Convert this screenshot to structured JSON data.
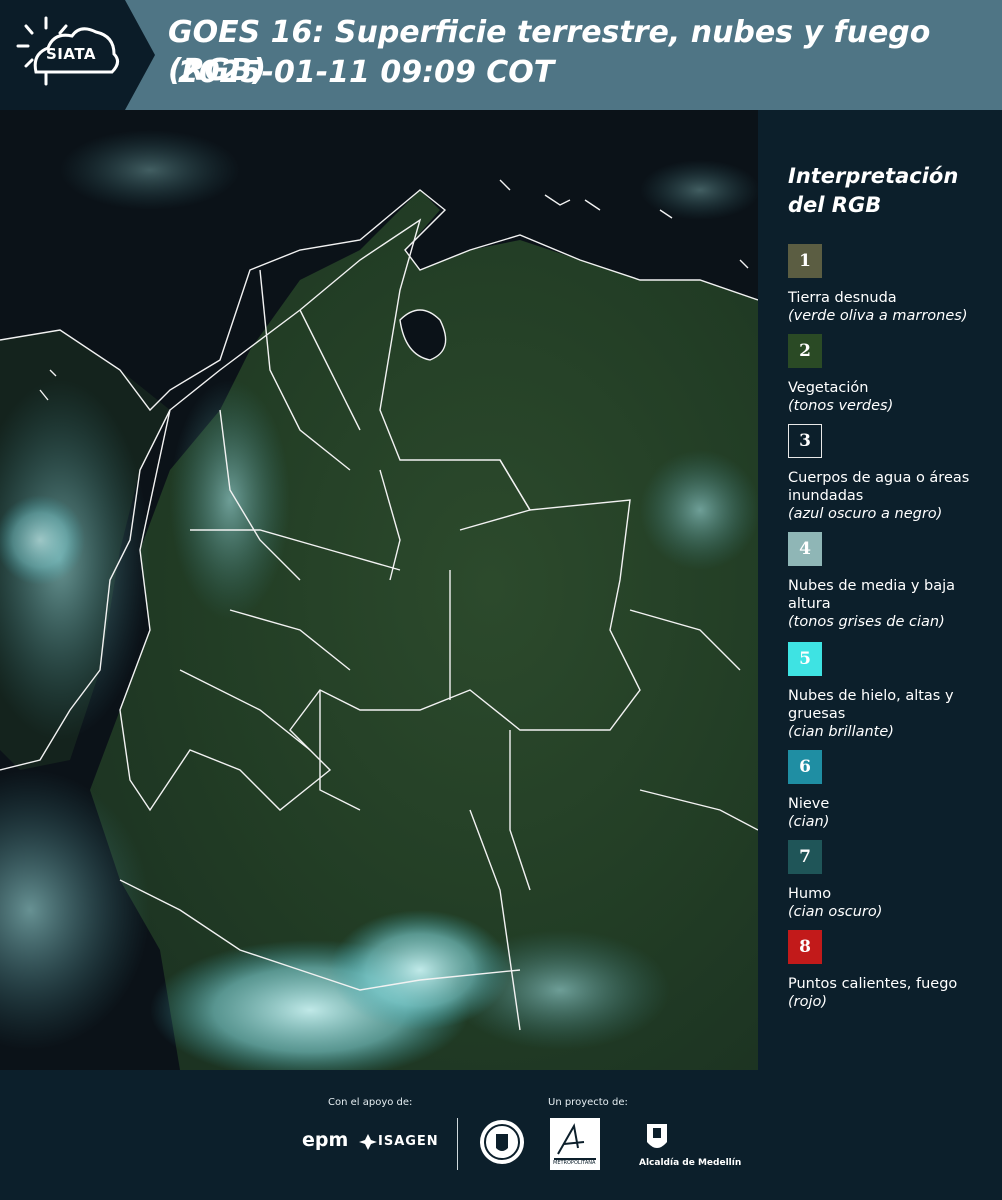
{
  "header": {
    "logo_text": "SIATA",
    "title": "GOES 16: Superficie terrestre, nubes y fuego (RGB)",
    "datetime": "2025-01-11 09:09 COT"
  },
  "legend": {
    "title": "Interpretación del RGB",
    "items": [
      {
        "number": "1",
        "label": "Tierra desnuda",
        "description": "(verde oliva a marrones)",
        "color": "#5b5d42"
      },
      {
        "number": "2",
        "label": "Vegetación",
        "description": "(tonos verdes)",
        "color": "#2a4a25"
      },
      {
        "number": "3",
        "label": "Cuerpos de agua o áreas inundadas",
        "description": "(azul oscuro a negro)",
        "color": "#0c1f2b"
      },
      {
        "number": "4",
        "label": "Nubes de media y baja altura",
        "description": "(tonos grises de cian)",
        "color": "#8fb6b6"
      },
      {
        "number": "5",
        "label": "Nubes de hielo, altas y gruesas",
        "description": "(cian brillante)",
        "color": "#3ee3e3"
      },
      {
        "number": "6",
        "label": "Nieve",
        "description": "(cian)",
        "color": "#1f8ea3"
      },
      {
        "number": "7",
        "label": "Humo",
        "description": "(cian oscuro)",
        "color": "#1f5558"
      },
      {
        "number": "8",
        "label": "Puntos calientes, fuego",
        "description": "(rojo)",
        "color": "#c21a1a"
      }
    ]
  },
  "footer": {
    "support_label": "Con el apoyo de:",
    "project_label": "Un proyecto de:",
    "sponsor_1": "epm",
    "sponsor_2": "ISAGEN",
    "partner_3": "METROPOLITANA",
    "partner_4": "Alcaldía de Medellín"
  },
  "icons": {
    "logo": "sun-cloud-icon",
    "medellin_seal": "seal-icon",
    "area_metropolitana": "area-logo-icon",
    "alcaldia": "coat-of-arms-icon"
  }
}
